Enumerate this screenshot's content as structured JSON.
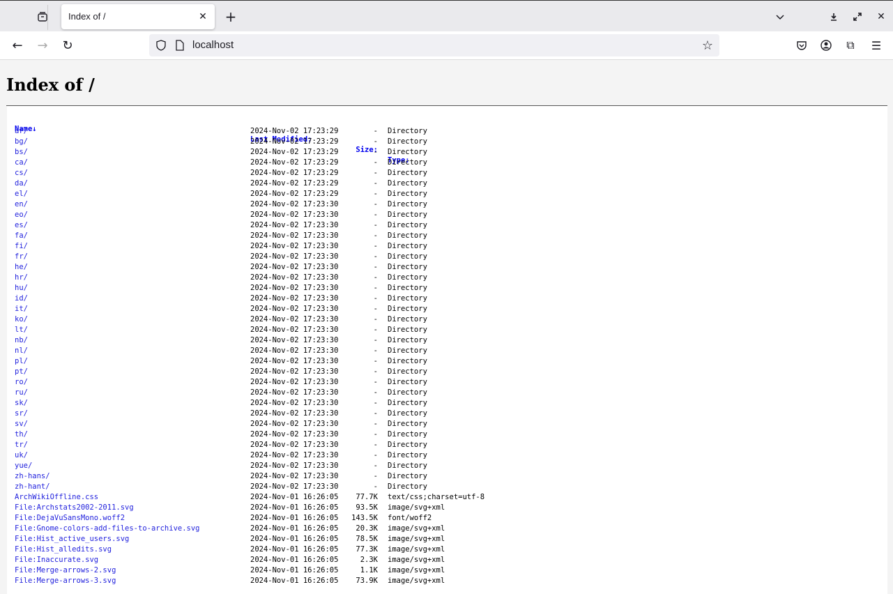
{
  "browser": {
    "tab_title": "Index of /",
    "url": "localhost"
  },
  "page": {
    "heading": "Index of /"
  },
  "columns": {
    "name": "Name↓",
    "modified": "Last Modified:",
    "size": "Size:",
    "type": "Type:"
  },
  "rows": [
    {
      "name": "ar/",
      "modified": "2024-Nov-02 17:23:29",
      "size": "-",
      "type": "Directory"
    },
    {
      "name": "bg/",
      "modified": "2024-Nov-02 17:23:29",
      "size": "-",
      "type": "Directory"
    },
    {
      "name": "bs/",
      "modified": "2024-Nov-02 17:23:29",
      "size": "-",
      "type": "Directory"
    },
    {
      "name": "ca/",
      "modified": "2024-Nov-02 17:23:29",
      "size": "-",
      "type": "Directory"
    },
    {
      "name": "cs/",
      "modified": "2024-Nov-02 17:23:29",
      "size": "-",
      "type": "Directory"
    },
    {
      "name": "da/",
      "modified": "2024-Nov-02 17:23:29",
      "size": "-",
      "type": "Directory"
    },
    {
      "name": "el/",
      "modified": "2024-Nov-02 17:23:29",
      "size": "-",
      "type": "Directory"
    },
    {
      "name": "en/",
      "modified": "2024-Nov-02 17:23:30",
      "size": "-",
      "type": "Directory"
    },
    {
      "name": "eo/",
      "modified": "2024-Nov-02 17:23:30",
      "size": "-",
      "type": "Directory"
    },
    {
      "name": "es/",
      "modified": "2024-Nov-02 17:23:30",
      "size": "-",
      "type": "Directory"
    },
    {
      "name": "fa/",
      "modified": "2024-Nov-02 17:23:30",
      "size": "-",
      "type": "Directory"
    },
    {
      "name": "fi/",
      "modified": "2024-Nov-02 17:23:30",
      "size": "-",
      "type": "Directory"
    },
    {
      "name": "fr/",
      "modified": "2024-Nov-02 17:23:30",
      "size": "-",
      "type": "Directory"
    },
    {
      "name": "he/",
      "modified": "2024-Nov-02 17:23:30",
      "size": "-",
      "type": "Directory"
    },
    {
      "name": "hr/",
      "modified": "2024-Nov-02 17:23:30",
      "size": "-",
      "type": "Directory"
    },
    {
      "name": "hu/",
      "modified": "2024-Nov-02 17:23:30",
      "size": "-",
      "type": "Directory"
    },
    {
      "name": "id/",
      "modified": "2024-Nov-02 17:23:30",
      "size": "-",
      "type": "Directory"
    },
    {
      "name": "it/",
      "modified": "2024-Nov-02 17:23:30",
      "size": "-",
      "type": "Directory"
    },
    {
      "name": "ko/",
      "modified": "2024-Nov-02 17:23:30",
      "size": "-",
      "type": "Directory"
    },
    {
      "name": "lt/",
      "modified": "2024-Nov-02 17:23:30",
      "size": "-",
      "type": "Directory"
    },
    {
      "name": "nb/",
      "modified": "2024-Nov-02 17:23:30",
      "size": "-",
      "type": "Directory"
    },
    {
      "name": "nl/",
      "modified": "2024-Nov-02 17:23:30",
      "size": "-",
      "type": "Directory"
    },
    {
      "name": "pl/",
      "modified": "2024-Nov-02 17:23:30",
      "size": "-",
      "type": "Directory"
    },
    {
      "name": "pt/",
      "modified": "2024-Nov-02 17:23:30",
      "size": "-",
      "type": "Directory"
    },
    {
      "name": "ro/",
      "modified": "2024-Nov-02 17:23:30",
      "size": "-",
      "type": "Directory"
    },
    {
      "name": "ru/",
      "modified": "2024-Nov-02 17:23:30",
      "size": "-",
      "type": "Directory"
    },
    {
      "name": "sk/",
      "modified": "2024-Nov-02 17:23:30",
      "size": "-",
      "type": "Directory"
    },
    {
      "name": "sr/",
      "modified": "2024-Nov-02 17:23:30",
      "size": "-",
      "type": "Directory"
    },
    {
      "name": "sv/",
      "modified": "2024-Nov-02 17:23:30",
      "size": "-",
      "type": "Directory"
    },
    {
      "name": "th/",
      "modified": "2024-Nov-02 17:23:30",
      "size": "-",
      "type": "Directory"
    },
    {
      "name": "tr/",
      "modified": "2024-Nov-02 17:23:30",
      "size": "-",
      "type": "Directory"
    },
    {
      "name": "uk/",
      "modified": "2024-Nov-02 17:23:30",
      "size": "-",
      "type": "Directory"
    },
    {
      "name": "yue/",
      "modified": "2024-Nov-02 17:23:30",
      "size": "-",
      "type": "Directory"
    },
    {
      "name": "zh-hans/",
      "modified": "2024-Nov-02 17:23:30",
      "size": "-",
      "type": "Directory"
    },
    {
      "name": "zh-hant/",
      "modified": "2024-Nov-02 17:23:30",
      "size": "-",
      "type": "Directory"
    },
    {
      "name": "ArchWikiOffline.css",
      "modified": "2024-Nov-01 16:26:05",
      "size": "77.7K",
      "type": "text/css;charset=utf-8"
    },
    {
      "name": "File:Archstats2002-2011.svg",
      "modified": "2024-Nov-01 16:26:05",
      "size": "93.5K",
      "type": "image/svg+xml"
    },
    {
      "name": "File:DejaVuSansMono.woff2",
      "modified": "2024-Nov-01 16:26:05",
      "size": "143.5K",
      "type": "font/woff2"
    },
    {
      "name": "File:Gnome-colors-add-files-to-archive.svg",
      "modified": "2024-Nov-01 16:26:05",
      "size": "20.3K",
      "type": "image/svg+xml"
    },
    {
      "name": "File:Hist_active_users.svg",
      "modified": "2024-Nov-01 16:26:05",
      "size": "78.5K",
      "type": "image/svg+xml"
    },
    {
      "name": "File:Hist_alledits.svg",
      "modified": "2024-Nov-01 16:26:05",
      "size": "77.3K",
      "type": "image/svg+xml"
    },
    {
      "name": "File:Inaccurate.svg",
      "modified": "2024-Nov-01 16:26:05",
      "size": "2.3K",
      "type": "image/svg+xml"
    },
    {
      "name": "File:Merge-arrows-2.svg",
      "modified": "2024-Nov-01 16:26:05",
      "size": "1.1K",
      "type": "image/svg+xml"
    },
    {
      "name": "File:Merge-arrows-3.svg",
      "modified": "2024-Nov-01 16:26:05",
      "size": "73.9K",
      "type": "image/svg+xml"
    }
  ]
}
